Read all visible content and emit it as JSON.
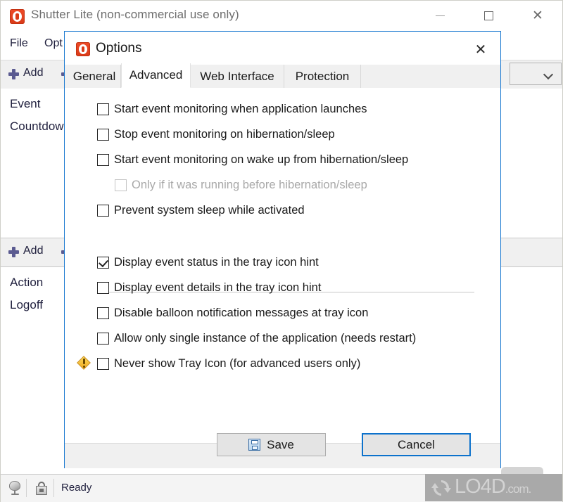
{
  "main_window": {
    "title": "Shutter Lite (non-commercial use only)",
    "app_icon": "shutter-icon",
    "window_controls": {
      "minimize": "minimize-icon",
      "maximize": "maximize-icon",
      "close": "close-icon"
    },
    "menu": [
      {
        "label": "File"
      },
      {
        "label": "Opt"
      }
    ],
    "toolbar_top": {
      "add_label": "Add",
      "plus_icon": "plus-icon",
      "minus_icon": "minus-icon",
      "dropdown_icon": "chevron-down-icon"
    },
    "list_top": {
      "rows": [
        {
          "label": "Event"
        },
        {
          "label": "Countdow"
        }
      ]
    },
    "toolbar_bottom": {
      "add_label": "Add",
      "plus_icon": "plus-icon",
      "minus_icon": "minus-icon"
    },
    "list_bottom": {
      "rows": [
        {
          "label": "Action"
        },
        {
          "label": "Logoff"
        }
      ]
    },
    "statusbar": {
      "network_icon": "globe-icon",
      "lock_icon": "lock-icon",
      "status_text": "Ready"
    },
    "watermark": {
      "text": "LO4D",
      "suffix": ".com."
    }
  },
  "dialog": {
    "title": "Options",
    "icon": "shutter-icon",
    "close_icon": "close-icon",
    "tabs": [
      {
        "label": "General",
        "active": false
      },
      {
        "label": "Advanced",
        "active": true
      },
      {
        "label": "Web Interface",
        "active": false
      },
      {
        "label": "Protection",
        "active": false
      }
    ],
    "group_one": [
      {
        "label": "Start event monitoring when application launches",
        "checked": false,
        "disabled": false,
        "indent": false,
        "warn": false
      },
      {
        "label": "Stop event monitoring on hibernation/sleep",
        "checked": false,
        "disabled": false,
        "indent": false,
        "warn": false
      },
      {
        "label": "Start event monitoring on wake up from hibernation/sleep",
        "checked": false,
        "disabled": false,
        "indent": false,
        "warn": false
      },
      {
        "label": "Only if it was running before hibernation/sleep",
        "checked": false,
        "disabled": true,
        "indent": true,
        "warn": false
      },
      {
        "label": "Prevent system sleep while activated",
        "checked": false,
        "disabled": false,
        "indent": false,
        "warn": false
      }
    ],
    "group_two": [
      {
        "label": "Display event status in the tray icon hint",
        "checked": true,
        "disabled": false,
        "indent": false,
        "warn": false
      },
      {
        "label": "Display event details in the tray icon hint",
        "checked": false,
        "disabled": false,
        "indent": false,
        "warn": false
      },
      {
        "label": "Disable balloon notification messages at tray icon",
        "checked": false,
        "disabled": false,
        "indent": false,
        "warn": false
      },
      {
        "label": "Allow only single instance of the application (needs restart)",
        "checked": false,
        "disabled": false,
        "indent": false,
        "warn": false
      },
      {
        "label": "Never show Tray Icon (for advanced users only)",
        "checked": false,
        "disabled": false,
        "indent": false,
        "warn": true
      }
    ],
    "buttons": {
      "save": "Save",
      "save_icon": "floppy-disk-icon",
      "cancel": "Cancel"
    }
  },
  "colors": {
    "dialog_border": "#1e7bd1",
    "focus_border": "#0d72cc",
    "accent_red": "#d93a18",
    "warning_yellow": "#f0a91e",
    "toolbar_bg": "#f0f0f0",
    "text": "#1a1a1a",
    "disabled_text": "#a8a8a8"
  }
}
